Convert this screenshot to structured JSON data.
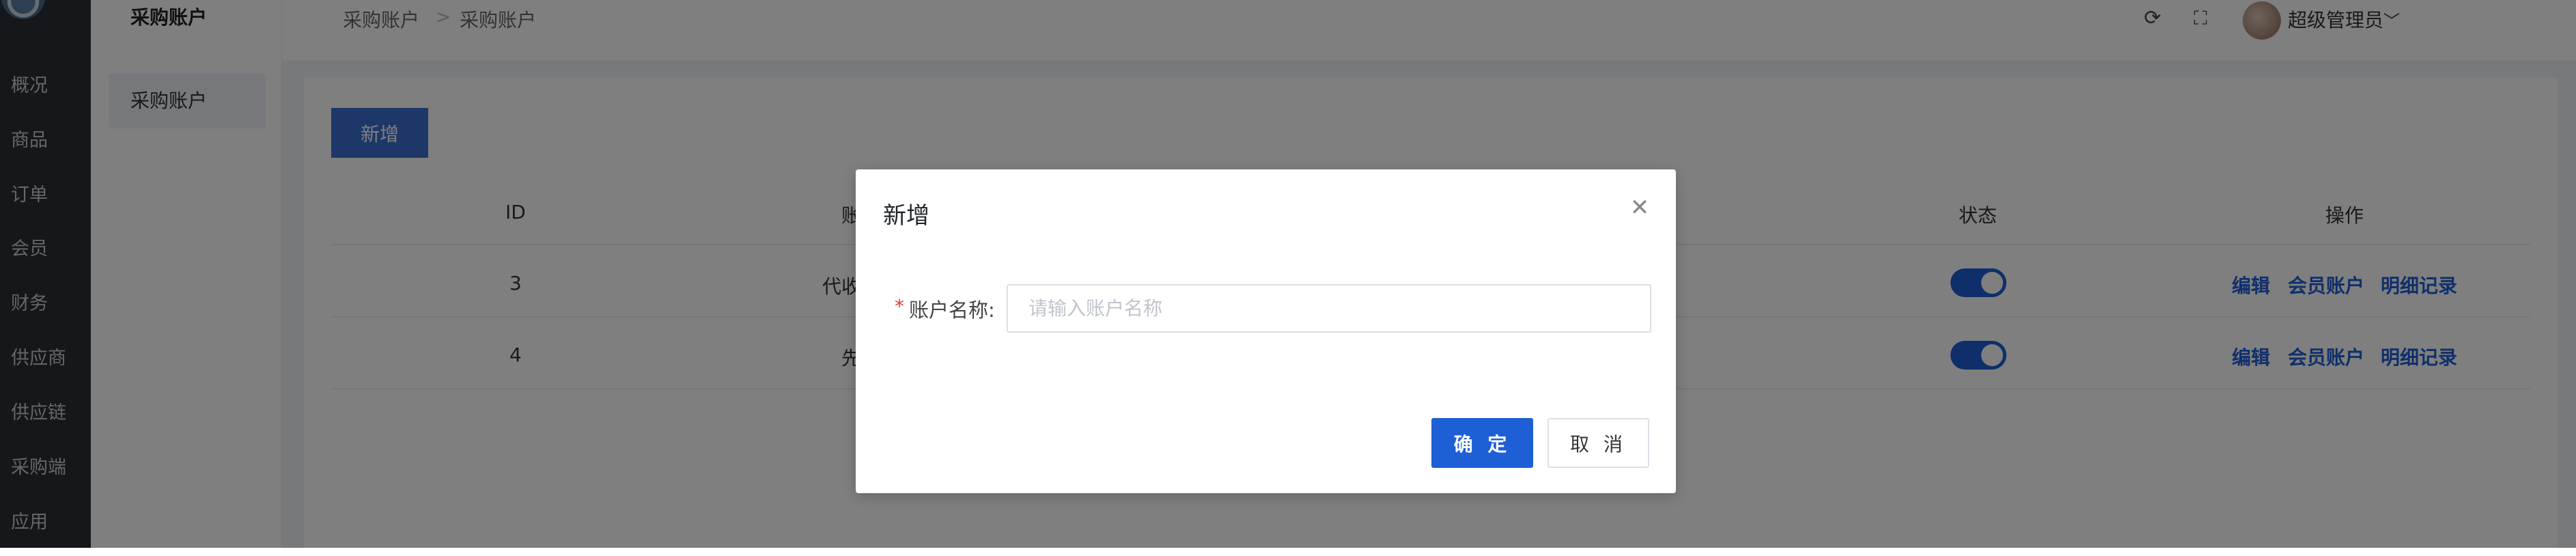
{
  "sidebar": {
    "items": [
      {
        "label": "概况"
      },
      {
        "label": "商品"
      },
      {
        "label": "订单"
      },
      {
        "label": "会员"
      },
      {
        "label": "财务"
      },
      {
        "label": "供应商"
      },
      {
        "label": "供应链"
      },
      {
        "label": "采购端"
      },
      {
        "label": "应用"
      }
    ]
  },
  "submenu": {
    "title": "采购账户",
    "active_item": "采购账户"
  },
  "header": {
    "breadcrumb": [
      "采购账户",
      "采购账户"
    ],
    "breadcrumb_separator": ">",
    "icons": {
      "refresh": "refresh-icon",
      "fullscreen": "fullscreen-icon"
    },
    "username": "超级管理员",
    "user_dropdown_icon": "chevron-down-icon"
  },
  "toolbar": {
    "add_label": "新增"
  },
  "table": {
    "headers": {
      "id": "ID",
      "name": "账",
      "status": "状态",
      "actions": "操作"
    },
    "rows": [
      {
        "id": "3",
        "name": "代收",
        "status_on": true
      },
      {
        "id": "4",
        "name": "先",
        "status_on": true
      }
    ],
    "row_actions": [
      "编辑",
      "会员账户",
      "明细记录"
    ]
  },
  "dialog": {
    "title": "新增",
    "close_icon": "close-icon",
    "required_mark": "*",
    "field_label": "账户名称:",
    "field_placeholder": "请输入账户名称",
    "field_value": "",
    "confirm_label": "确 定",
    "cancel_label": "取 消"
  },
  "colors": {
    "primary": "#1e5fd6",
    "nav_bg": "#2b2f36",
    "required": "#e03c3c"
  }
}
